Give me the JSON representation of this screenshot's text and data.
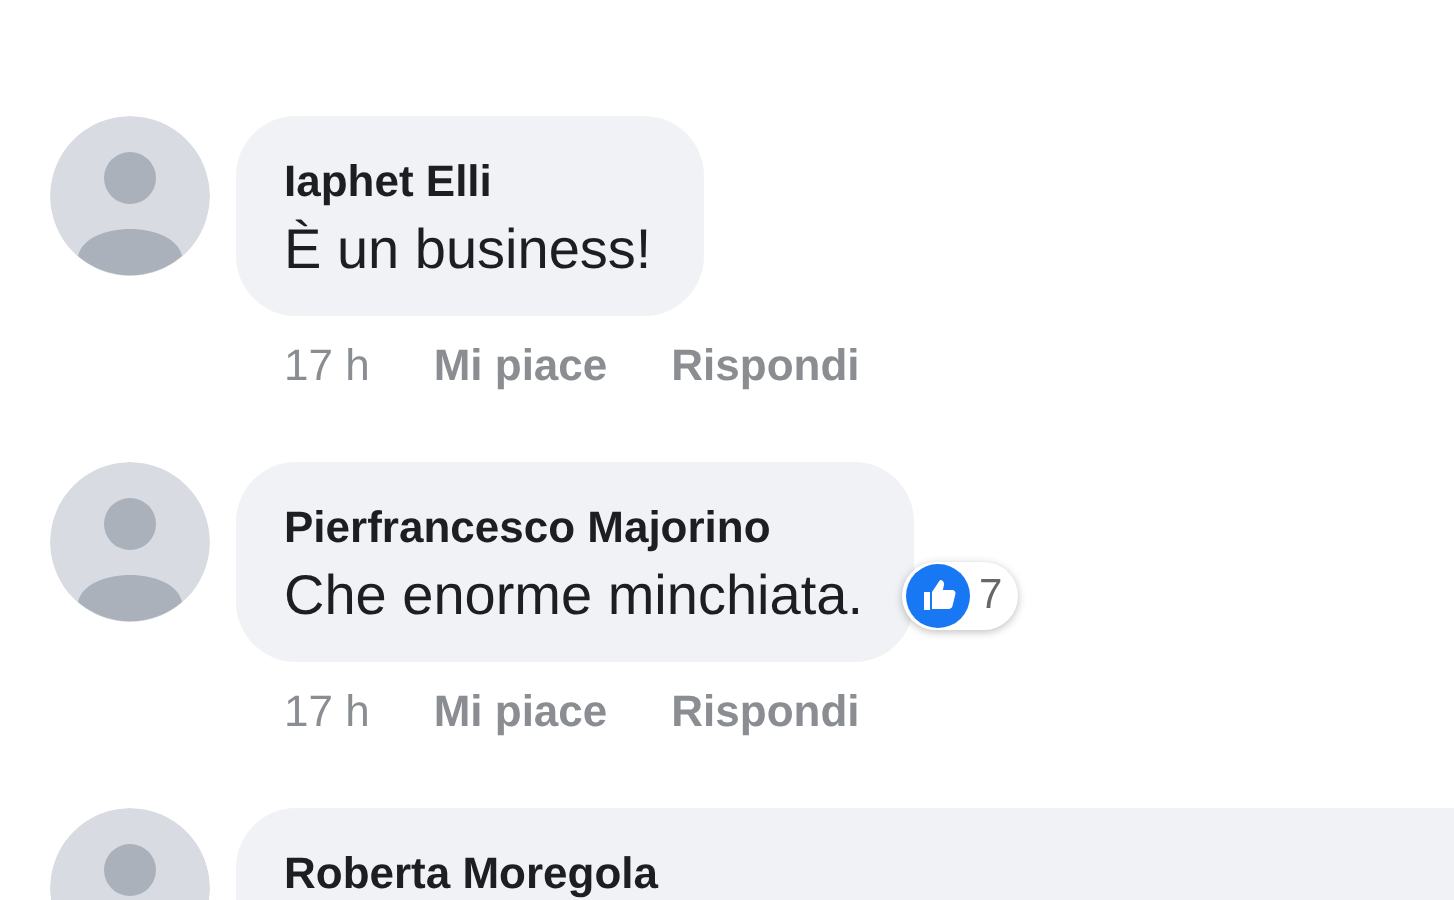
{
  "comments": [
    {
      "author": "Iaphet Elli",
      "text": "È un business!",
      "time": "17 h",
      "like": "Mi piace",
      "reply": "Rispondi"
    },
    {
      "author": "Pierfrancesco Majorino",
      "text": "Che enorme minchiata.",
      "time": "17 h",
      "like": "Mi piace",
      "reply": "Rispondi",
      "reaction_count": "7"
    },
    {
      "author": "Roberta Moregola"
    }
  ]
}
